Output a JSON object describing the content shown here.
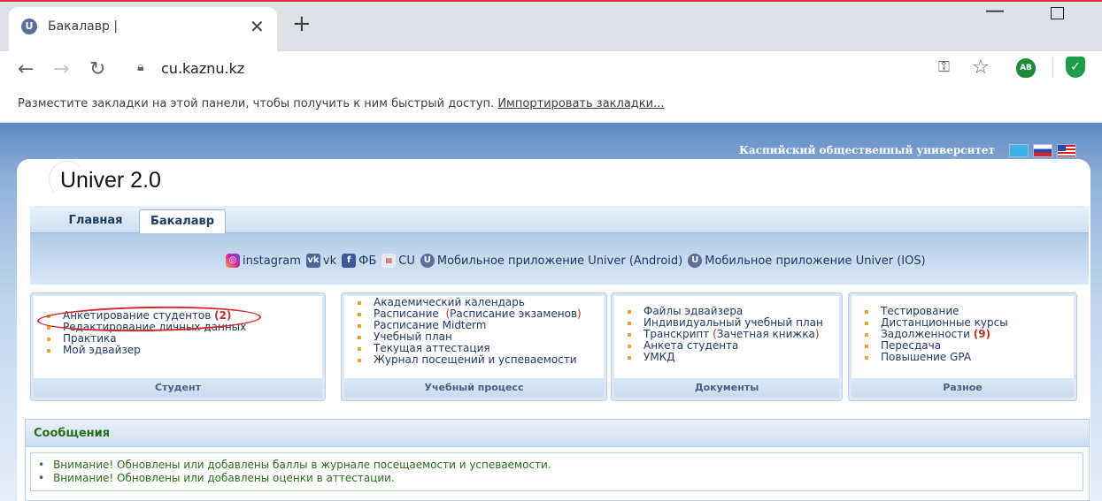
{
  "browser": {
    "tab_title": "Бакалавр |",
    "new_tab_icon": "+",
    "url": "cu.kaznu.kz",
    "ext_ab_label": "AB",
    "bookmarks_text": "Разместите закладки на этой панели, чтобы получить к ним быстрый доступ.",
    "bookmarks_link": "Импортировать закладки..."
  },
  "header": {
    "university": "Каспийский общественный университет",
    "logo": "Univer 2.0"
  },
  "tabs": [
    {
      "label": "Главная"
    },
    {
      "label": "Бакалавр"
    }
  ],
  "links": [
    {
      "icon": "instagram",
      "label": "instagram"
    },
    {
      "icon": "vk",
      "label": "vk"
    },
    {
      "icon": "facebook",
      "label": "ФБ"
    },
    {
      "icon": "cu",
      "label": "CU"
    },
    {
      "icon": "univer",
      "label": "Мобильное приложение Univer (Android)"
    },
    {
      "icon": "univer",
      "label": "Мобильное приложение Univer (IOS)"
    }
  ],
  "boxes": [
    {
      "title": "Студент",
      "items": [
        "Анкетирование студентов",
        "Редактирование личных данных",
        "Практика",
        "Мой эдвайзер"
      ],
      "counts": [
        "(2)"
      ]
    },
    {
      "title": "Учебный процесс",
      "items": [
        "Академический календарь",
        "Расписание",
        "Расписание Midterm",
        "Учебный план",
        "Текущая аттестация",
        "Журнал посещений и успеваемости"
      ],
      "extra": [
        "(",
        "Расписание экзаменов",
        ")"
      ]
    },
    {
      "title": "Документы",
      "items": [
        "Файлы эдвайзера",
        "Индивидуальный учебный план",
        "Транскрипт",
        "Анкета студента",
        "УМКД"
      ],
      "extra": [
        "(",
        "Зачетная книжка",
        ")"
      ]
    },
    {
      "title": "Разное",
      "items": [
        "Тестирование",
        "Дистанционные курсы",
        "Задолженности",
        "Пересдача",
        "Повышение GPA"
      ],
      "counts": [
        "(9)"
      ]
    }
  ],
  "messages": {
    "title": "Сообщения",
    "items": [
      "Внимание! Обновлены или добавлены баллы в журнале посещаемости и успеваемости.",
      "Внимание! Обновлены или добавлены оценки в аттестации."
    ]
  },
  "colors": {
    "annotation": "#d6262c",
    "message_text": "#2b6e1a"
  }
}
